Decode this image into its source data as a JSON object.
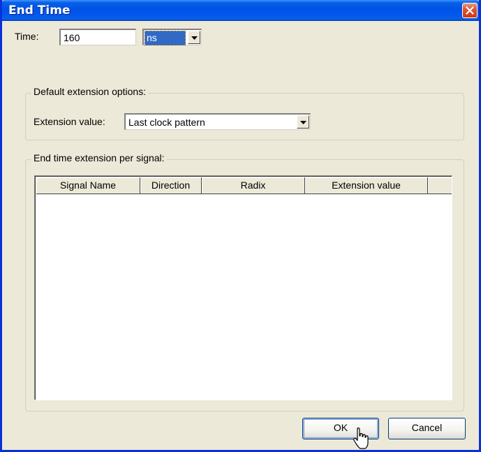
{
  "window": {
    "title": "End Time"
  },
  "time": {
    "label": "Time:",
    "value": "160",
    "unit": "ns"
  },
  "default_extension": {
    "group_label": "Default extension options:",
    "extension_label": "Extension value:",
    "extension_value": "Last clock pattern"
  },
  "per_signal": {
    "group_label": "End time extension per signal:",
    "columns": [
      "Signal Name",
      "Direction",
      "Radix",
      "Extension value"
    ],
    "rows": []
  },
  "buttons": {
    "ok": "OK",
    "cancel": "Cancel"
  },
  "colors": {
    "titlebar": "#0054e3",
    "dialog_bg": "#ece9d8",
    "selection": "#316ac5",
    "close_button": "#dd5a37"
  },
  "icons": {
    "close": "close-icon",
    "dropdown": "chevron-down-icon",
    "cursor": "mouse-pointer-icon"
  }
}
